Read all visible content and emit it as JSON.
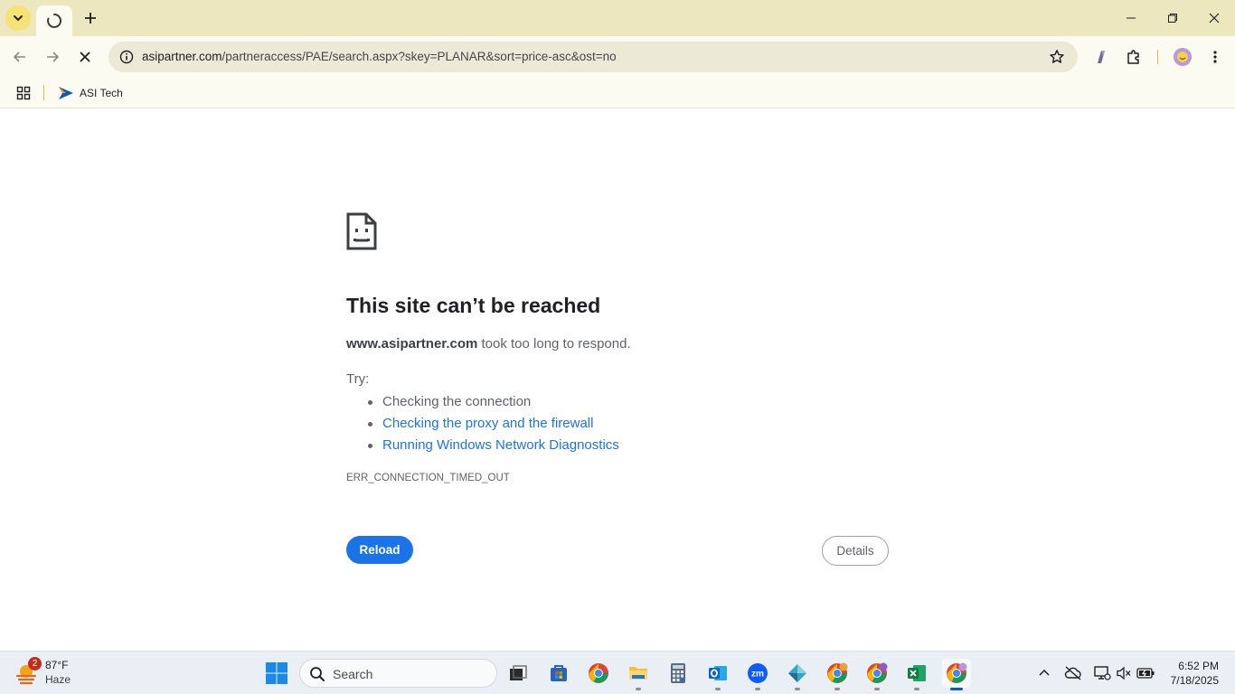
{
  "browser": {
    "new_tab_label": "+",
    "url_host": "asipartner.com",
    "url_path": "/partneraccess/PAE/search.aspx?skey=PLANAR&sort=price-asc&ost=no"
  },
  "bookmarks": {
    "items": [
      {
        "label": "ASI Tech",
        "icon": "asi-tech-icon"
      }
    ]
  },
  "error_page": {
    "title": "This site can’t be reached",
    "host": "www.asipartner.com",
    "message": " took too long to respond.",
    "try_label": "Try:",
    "suggestions": [
      {
        "label": "Checking the connection",
        "link": false
      },
      {
        "label": "Checking the proxy and the firewall",
        "link": true
      },
      {
        "label": "Running Windows Network Diagnostics",
        "link": true
      }
    ],
    "error_code": "ERR_CONNECTION_TIMED_OUT",
    "reload_label": "Reload",
    "details_label": "Details"
  },
  "taskbar": {
    "weather_badge": "2",
    "weather_temp": "87°F",
    "weather_condition": "Haze",
    "search_placeholder": "Search",
    "time": "6:52 PM",
    "date": "7/18/2025",
    "apps": [
      "task-view",
      "store",
      "chrome",
      "file-explorer",
      "calculator",
      "outlook",
      "zoom",
      "app-diamond",
      "chrome-profile-2",
      "chrome-profile-3",
      "excel",
      "chrome-profile-active"
    ]
  },
  "colors": {
    "tabstrip": "#ede7bf",
    "toolbar": "#fbfbf1",
    "link": "#1a73e8",
    "reload_button": "#1a73e8",
    "taskbar": "#eaeff5"
  }
}
